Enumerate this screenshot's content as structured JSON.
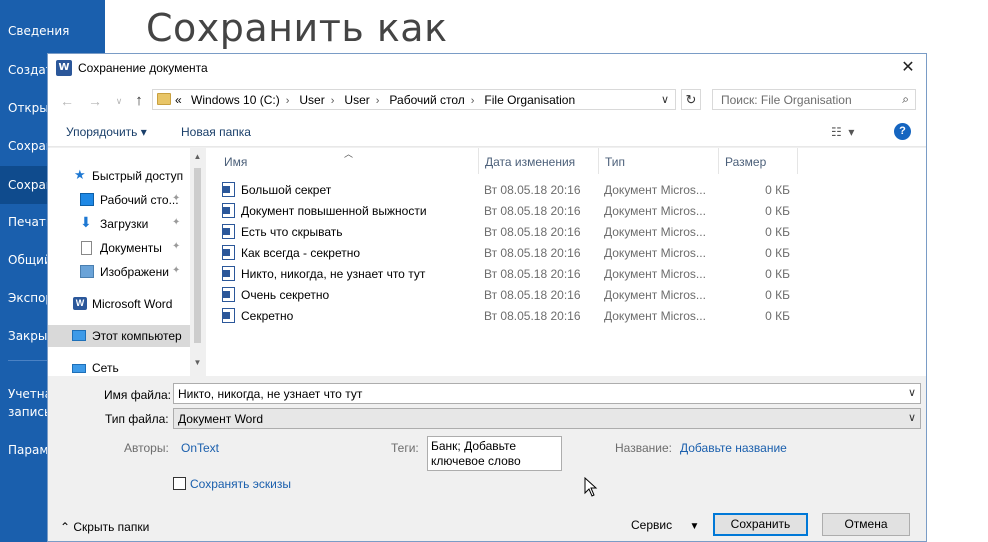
{
  "backstage": {
    "title": "Сохранить как",
    "nav_items": [
      "Сведения",
      "Создать",
      "Открыть",
      "Сохранить",
      "Сохранить как",
      "Печать",
      "Общий доступ",
      "Экспорт",
      "Закрыть",
      "Учетная запись",
      "Параметры"
    ],
    "nav_display": [
      "Сведения",
      "Создат",
      "Откры",
      "Сохран",
      "Сохран",
      "Печать",
      "Общий",
      "Экспор",
      "Закры",
      "Учетна",
      "запись",
      "Парам"
    ]
  },
  "dialog": {
    "title": "Сохранение документа",
    "app_icon": "word-icon",
    "breadcrumbs_prefix": "«",
    "breadcrumbs": [
      "Windows 10 (C:)",
      "User",
      "User",
      "Рабочий стол",
      "File Organisation"
    ],
    "search_placeholder": "Поиск: File Organisation",
    "toolbar": {
      "organize_label": "Упорядочить ▾",
      "new_folder_label": "Новая папка"
    },
    "navpane": [
      {
        "label": "Быстрый доступ",
        "icon": "star-icon"
      },
      {
        "label": "Рабочий сто...",
        "icon": "desktop-icon",
        "pinned": true
      },
      {
        "label": "Загрузки",
        "icon": "download-icon",
        "pinned": true
      },
      {
        "label": "Документы",
        "icon": "documents-icon",
        "pinned": true
      },
      {
        "label": "Изображени",
        "icon": "pictures-icon",
        "pinned": true
      },
      {
        "label": "Microsoft Word",
        "icon": "word-icon"
      },
      {
        "label": "Этот компьютер",
        "icon": "computer-icon",
        "selected": true
      },
      {
        "label": "Сеть",
        "icon": "network-icon"
      }
    ],
    "columns": {
      "name": "Имя",
      "date": "Дата изменения",
      "type": "Тип",
      "size": "Размер"
    },
    "files": [
      {
        "name": "Большой секрет",
        "date": "Вт 08.05.18 20:16",
        "type": "Документ Micros...",
        "size": "0 КБ"
      },
      {
        "name": "Документ повышенной выжности",
        "date": "Вт 08.05.18 20:16",
        "type": "Документ Micros...",
        "size": "0 КБ"
      },
      {
        "name": "Есть что скрывать",
        "date": "Вт 08.05.18 20:16",
        "type": "Документ Micros...",
        "size": "0 КБ"
      },
      {
        "name": "Как всегда - секретно",
        "date": "Вт 08.05.18 20:16",
        "type": "Документ Micros...",
        "size": "0 КБ"
      },
      {
        "name": "Никто, никогда, не узнает что тут",
        "date": "Вт 08.05.18 20:16",
        "type": "Документ Micros...",
        "size": "0 КБ"
      },
      {
        "name": "Очень секретно",
        "date": "Вт 08.05.18 20:16",
        "type": "Документ Micros...",
        "size": "0 КБ"
      },
      {
        "name": "Секретно",
        "date": "Вт 08.05.18 20:16",
        "type": "Документ Micros...",
        "size": "0 КБ"
      }
    ],
    "filename_label": "Имя файла:",
    "filename_value": "Никто, никогда, не узнает что тут",
    "filetype_label": "Тип файла:",
    "filetype_value": "Документ Word",
    "authors_label": "Авторы:",
    "authors_value": "OnText",
    "tags_label": "Теги:",
    "tags_value_line1": "Банк; Добавьте",
    "tags_value_line2": "ключевое слово",
    "title_label": "Название:",
    "title_value": "Добавьте название",
    "thumbnails_label": "Сохранять эскизы",
    "hide_folders_label": "⌃  Скрыть папки",
    "service_label": "Сервис",
    "save_label": "Сохранить",
    "cancel_label": "Отмена"
  }
}
